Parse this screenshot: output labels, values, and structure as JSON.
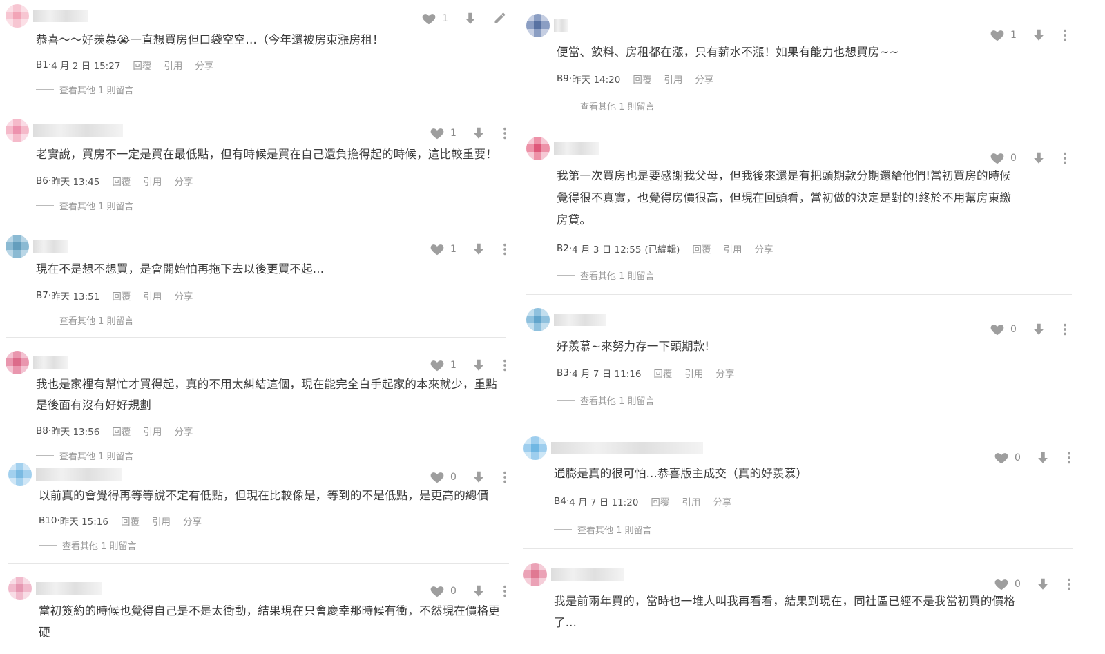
{
  "ui_text": {
    "reply": "回覆",
    "quote": "引用",
    "share": "分享",
    "more_replies": "查看其他 1 則留言"
  },
  "colors": {
    "icon_gray": "#9e9e9e",
    "text": "#3c3c3c",
    "meta": "#555555"
  },
  "comments": [
    {
      "id": "B1",
      "avatar_colors": [
        "#f08fa6",
        "#f6b9c8",
        "#fbd8e1"
      ],
      "text_lines": [
        "恭喜～～好羨慕😭一直想買房但口袋空空…（今年還被房東漲房租！"
      ],
      "likes": "1",
      "menu_icon": "pencil-icon",
      "floor": "B1",
      "time": "4 月 2 日 15:27",
      "edited": ""
    },
    {
      "id": "B6",
      "avatar_colors": [
        "#e9789a",
        "#f3a9be",
        "#fad3df"
      ],
      "text_lines": [
        "老實說，買房不一定是買在最低點，但有時候是買在自己還負擔得起的時候，這比較重要！"
      ],
      "likes": "1",
      "menu_icon": "more-vertical-icon",
      "floor": "B6",
      "time": "昨天 13:45",
      "edited": ""
    },
    {
      "id": "B7",
      "avatar_colors": [
        "#3e86ad",
        "#6fa9c9",
        "#a8cde1"
      ],
      "text_lines": [
        "現在不是想不想買，是會開始怕再拖下去以後更買不起..."
      ],
      "likes": "1",
      "menu_icon": "more-vertical-icon",
      "floor": "B7",
      "time": "昨天 13:51",
      "edited": ""
    },
    {
      "id": "B8",
      "avatar_colors": [
        "#d4476e",
        "#e47d9b",
        "#f1b4c6"
      ],
      "text_lines": [
        "我也是家裡有幫忙才買得起，真的不用太糾結這個，現在能完全白手起家的本來就少，重點",
        "是後面有沒有好好規劃"
      ],
      "likes": "1",
      "menu_icon": "more-vertical-icon",
      "floor": "B8",
      "time": "昨天 13:56",
      "edited": ""
    },
    {
      "id": "B10",
      "avatar_colors": [
        "#5aa9dc",
        "#8cc5ea",
        "#c4e1f4"
      ],
      "text_lines": [
        "以前真的會覺得再等等說不定有低點，但現在比較像是，等到的不是低點，是更高的總價"
      ],
      "likes": "0",
      "menu_icon": "more-vertical-icon",
      "floor": "B10",
      "time": "昨天 15:16",
      "edited": ""
    },
    {
      "id": "B11",
      "avatar_colors": [
        "#e17fa0",
        "#eeaac0",
        "#f7d5e0"
      ],
      "text_lines": [
        "當初簽約的時候也覺得自己是不是太衝動，結果現在只會慶幸那時候有衝，不然現在價格更",
        "硬"
      ],
      "likes": "0",
      "menu_icon": "more-vertical-icon"
    },
    {
      "id": "B9",
      "avatar_colors": [
        "#2f4f8c",
        "#6f86b5",
        "#b7c3dc"
      ],
      "text_lines": [
        "便當、飲料、房租都在漲，只有薪水不漲！如果有能力也想買房~~"
      ],
      "likes": "1",
      "menu_icon": "more-vertical-icon",
      "floor": "B9",
      "time": "昨天 14:20",
      "edited": ""
    },
    {
      "id": "B2",
      "avatar_colors": [
        "#d82f5a",
        "#e97793",
        "#f5bccb"
      ],
      "text_lines": [
        "我第一次買房也是要感謝我父母，但我後來還是有把頭期款分期還給他們!當初買房的時候",
        "覺得很不真實，也覺得房價很高，但現在回頭看，當初做的決定是對的!終於不用幫房東繳",
        "房貸。"
      ],
      "likes": "0",
      "menu_icon": "more-vertical-icon",
      "floor": "B2",
      "time": "4 月 3 日 12:55",
      "edited": "(已編輯)"
    },
    {
      "id": "B3",
      "avatar_colors": [
        "#3b8fc0",
        "#74b2d6",
        "#b3d6ea"
      ],
      "text_lines": [
        "好羨慕~來努力存一下頭期款!"
      ],
      "likes": "0",
      "menu_icon": "more-vertical-icon",
      "floor": "B3",
      "time": "4 月 7 日 11:16",
      "edited": ""
    },
    {
      "id": "B4",
      "avatar_colors": [
        "#4da6dd",
        "#86c3ea",
        "#c0e0f5"
      ],
      "text_lines": [
        "通膨是真的很可怕...恭喜版主成交（真的好羨慕）"
      ],
      "likes": "0",
      "menu_icon": "more-vertical-icon",
      "floor": "B4",
      "time": "4 月 7 日 11:20",
      "edited": ""
    },
    {
      "id": "B5",
      "avatar_colors": [
        "#d95878",
        "#e78ca4",
        "#f3c3d0"
      ],
      "text_lines": [
        "我是前兩年買的，當時也一堆人叫我再看看，結果到現在，同社區已經不是我當初買的價格",
        "了..."
      ],
      "likes": "0",
      "menu_icon": "more-vertical-icon"
    }
  ]
}
